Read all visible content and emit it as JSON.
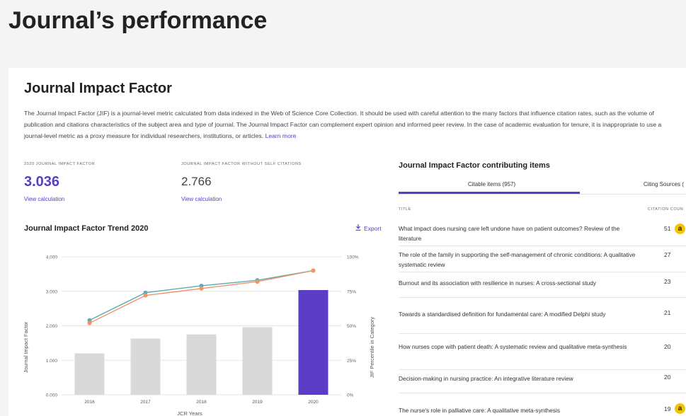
{
  "page_title": "Journal’s performance",
  "section": {
    "title": "Journal Impact Factor",
    "description": "The Journal Impact Factor (JIF) is a journal-level metric calculated from data indexed in the Web of Science Core Collection. It should be used with careful attention to the many factors that influence citation rates, such as the volume of publication and citations characteristics of the subject area and type of journal. The Journal Impact Factor can complement expert opinion and informed peer review. In the case of academic evaluation for tenure, it is inappropriate to use a journal-level metric as a proxy measure for individual researchers, institutions, or articles.",
    "learn_more": "Learn more"
  },
  "metrics": {
    "jif": {
      "label": "2020 Journal Impact Factor",
      "value": "3.036",
      "link": "View calculation"
    },
    "jif_no_self": {
      "label": "Journal Impact Factor without self citations",
      "value": "2.766",
      "link": "View calculation"
    }
  },
  "trend": {
    "title": "Journal Impact Factor Trend 2020",
    "export_label": "Export"
  },
  "chart_data": {
    "type": "bar",
    "categories": [
      "2016",
      "2017",
      "2018",
      "2019",
      "2020"
    ],
    "series": [
      {
        "type": "bar",
        "values": [
          1.2,
          1.63,
          1.75,
          1.96,
          3.036
        ]
      },
      {
        "type": "line",
        "axis": "right",
        "values": [
          54,
          74,
          79,
          83,
          90
        ]
      },
      {
        "type": "line",
        "axis": "right",
        "values": [
          52,
          72,
          77,
          82,
          90
        ]
      }
    ],
    "xlabel": "JCR Years",
    "ylabel": "Journal Impact Factor",
    "ylabel_right": "JIF Percentile in Category",
    "yticks": [
      "0.000",
      "1.000",
      "2.000",
      "3.000",
      "4.000"
    ],
    "yticks_right": [
      "0%",
      "25%",
      "50%",
      "75%",
      "100%"
    ],
    "ylim": [
      0,
      4
    ],
    "ylim_right": [
      0,
      100
    ],
    "colors": {
      "bar": "#d9d9d9",
      "bar_highlight": "#5b3cc4",
      "line_teal": "#5fa9b3",
      "line_orange": "#f0956a"
    },
    "grid": true
  },
  "contrib": {
    "title": "Journal Impact Factor contributing items",
    "tabs": [
      {
        "label": "Citable items (957)"
      },
      {
        "label": "Citing Sources ("
      }
    ],
    "col_title": "Title",
    "col_count": "Citation coun",
    "badge_glyph": "a",
    "rows": [
      {
        "title": "What impact does nursing care left undone have on patient outcomes? Review of the literature",
        "count": "51",
        "badge": true
      },
      {
        "title": "The role of the family in supporting the self-management of chronic conditions: A qualitative systematic review",
        "count": "27",
        "badge": false
      },
      {
        "title": "Burnout and its association with resilience in nurses: A cross-sectional study",
        "count": "23",
        "badge": false
      },
      {
        "title": "Towards a standardised definition for fundamental care: A modified Delphi study",
        "count": "21",
        "badge": false
      },
      {
        "title": "How nurses cope with patient death: A systematic review and qualitative meta-synthesis",
        "count": "20",
        "badge": false
      },
      {
        "title": "Decision-making in nursing practice: An integrative literature review",
        "count": "20",
        "badge": false
      },
      {
        "title": "The nurse's role in palliative care: A qualitative meta-synthesis",
        "count": "19",
        "badge": true
      }
    ]
  }
}
